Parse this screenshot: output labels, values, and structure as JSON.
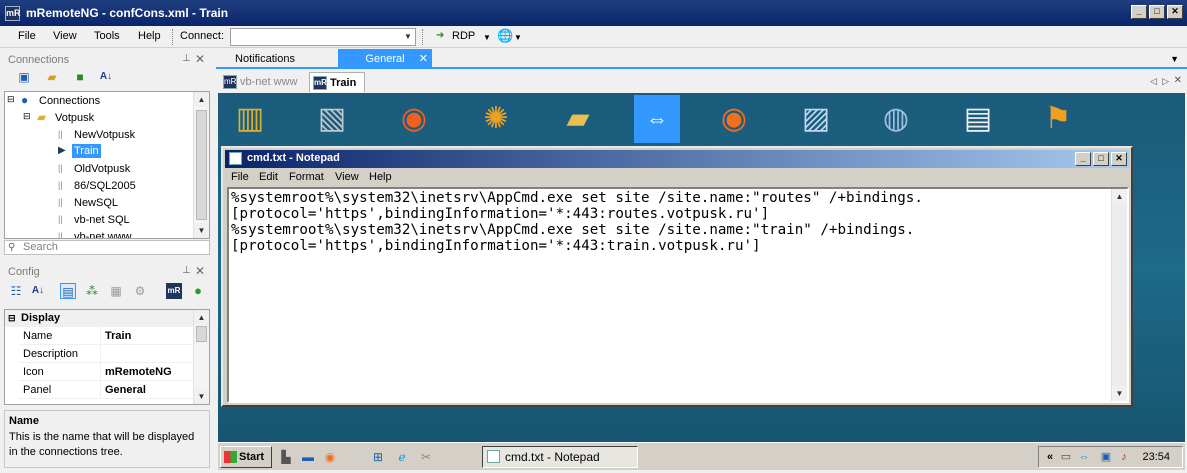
{
  "window": {
    "title": "mRemoteNG - confCons.xml - Train",
    "icon_label": "mR"
  },
  "menu": {
    "items": [
      "File",
      "View",
      "Tools",
      "Help"
    ],
    "connect_label": "Connect:",
    "connect_value": "",
    "protocol_label": "RDP"
  },
  "connections_panel": {
    "title": "Connections",
    "tree": [
      {
        "label": "Connections",
        "level": 0,
        "icon": "globe-icon"
      },
      {
        "label": "Votpusk",
        "level": 1,
        "icon": "folder-icon"
      },
      {
        "label": "NewVotpusk",
        "level": 2,
        "icon": "connection-icon"
      },
      {
        "label": "Train",
        "level": 2,
        "icon": "play-icon",
        "selected": true
      },
      {
        "label": "OldVotpusk",
        "level": 2,
        "icon": "connection-icon"
      },
      {
        "label": "86/SQL2005",
        "level": 2,
        "icon": "connection-icon"
      },
      {
        "label": "NewSQL",
        "level": 2,
        "icon": "connection-icon"
      },
      {
        "label": "vb-net SQL",
        "level": 2,
        "icon": "connection-icon"
      },
      {
        "label": "vb-net www",
        "level": 2,
        "icon": "connection-icon"
      }
    ],
    "search_placeholder": "Search"
  },
  "config_panel": {
    "title": "Config",
    "category": "Display",
    "properties": [
      {
        "key": "Name",
        "value": "Train"
      },
      {
        "key": "Description",
        "value": ""
      },
      {
        "key": "Icon",
        "value": "mRemoteNG"
      },
      {
        "key": "Panel",
        "value": "General"
      }
    ],
    "description_title": "Name",
    "description_text": "This is the name that will be displayed in the connections tree."
  },
  "panel_tabs": [
    {
      "label": "Notifications",
      "active": false
    },
    {
      "label": "General",
      "active": true
    }
  ],
  "doc_tabs": [
    {
      "label": "vb-net www",
      "active": false
    },
    {
      "label": "Train",
      "active": true
    }
  ],
  "notepad": {
    "title": "cmd.txt - Notepad",
    "menu": [
      "File",
      "Edit",
      "Format",
      "View",
      "Help"
    ],
    "content": "%systemroot%\\system32\\inetsrv\\AppCmd.exe set site /site.name:\"routes\" /+bindings.\n[protocol='https',bindingInformation='*:443:routes.votpusk.ru']\n%systemroot%\\system32\\inetsrv\\AppCmd.exe set site /site.name:\"train\" /+bindings.\n[protocol='https',bindingInformation='*:443:train.votpusk.ru']"
  },
  "taskbar": {
    "start_label": "Start",
    "task_label": "cmd.txt - Notepad",
    "clock": "23:54"
  },
  "colors": {
    "accent": "#3399ff",
    "titlebar": "#0a246a",
    "desktop": "#1d6a8a"
  }
}
